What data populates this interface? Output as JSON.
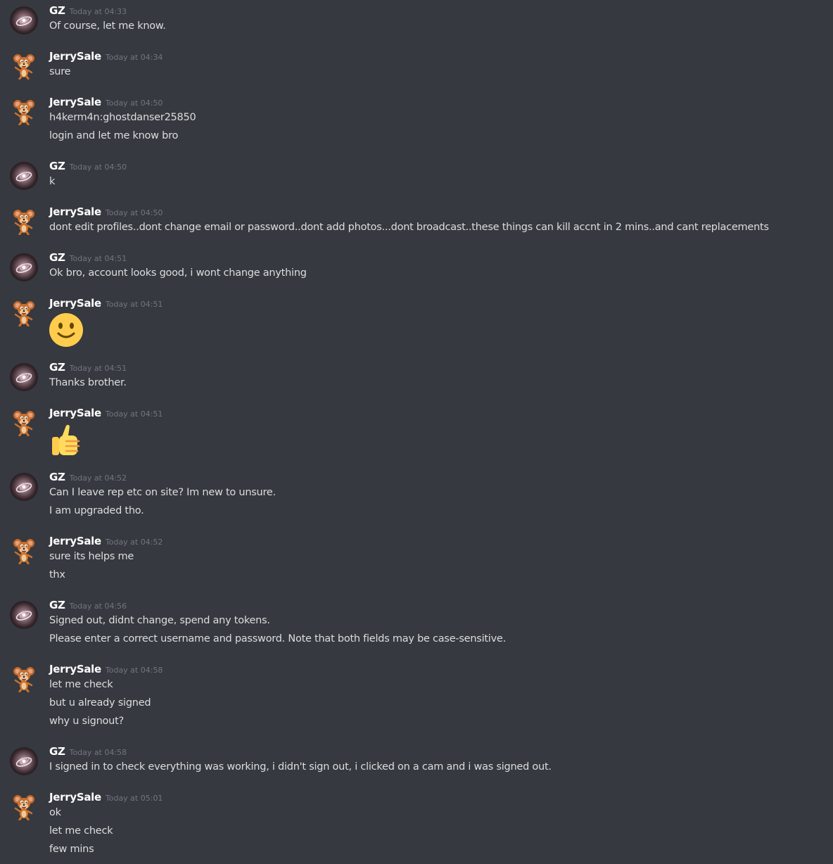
{
  "messages": [
    {
      "author": "GZ",
      "avatar_icon": "gz-nebula-avatar-icon",
      "timestamp": "Today at 04:33",
      "lines": [
        "Of course, let me know."
      ]
    },
    {
      "author": "JerrySale",
      "avatar_icon": "jerry-mouse-avatar-icon",
      "timestamp": "Today at 04:34",
      "lines": [
        "sure"
      ]
    },
    {
      "author": "JerrySale",
      "avatar_icon": "jerry-mouse-avatar-icon",
      "timestamp": "Today at 04:50",
      "lines": [
        "h4kerm4n:ghostdanser25850",
        "login and let me know bro"
      ]
    },
    {
      "author": "GZ",
      "avatar_icon": "gz-nebula-avatar-icon",
      "timestamp": "Today at 04:50",
      "lines": [
        "k"
      ]
    },
    {
      "author": "JerrySale",
      "avatar_icon": "jerry-mouse-avatar-icon",
      "timestamp": "Today at 04:50",
      "lines": [
        "dont edit profiles..dont change email or password..dont add photos...dont broadcast..these things can kill accnt in 2 mins..and cant replacements"
      ]
    },
    {
      "author": "GZ",
      "avatar_icon": "gz-nebula-avatar-icon",
      "timestamp": "Today at 04:51",
      "lines": [
        "Ok bro, account looks good, i wont change anything"
      ]
    },
    {
      "author": "JerrySale",
      "avatar_icon": "jerry-mouse-avatar-icon",
      "timestamp": "Today at 04:51",
      "lines": [],
      "emoji": "slightly-smiling-face-emoji"
    },
    {
      "author": "GZ",
      "avatar_icon": "gz-nebula-avatar-icon",
      "timestamp": "Today at 04:51",
      "lines": [
        "Thanks brother."
      ]
    },
    {
      "author": "JerrySale",
      "avatar_icon": "jerry-mouse-avatar-icon",
      "timestamp": "Today at 04:51",
      "lines": [],
      "emoji": "thumbs-up-emoji"
    },
    {
      "author": "GZ",
      "avatar_icon": "gz-nebula-avatar-icon",
      "timestamp": "Today at 04:52",
      "lines": [
        "Can I leave rep etc on site? Im new to unsure.",
        "I am upgraded tho."
      ]
    },
    {
      "author": "JerrySale",
      "avatar_icon": "jerry-mouse-avatar-icon",
      "timestamp": "Today at 04:52",
      "lines": [
        "sure its helps me",
        "thx"
      ]
    },
    {
      "author": "GZ",
      "avatar_icon": "gz-nebula-avatar-icon",
      "timestamp": "Today at 04:56",
      "lines": [
        "Signed out, didnt change, spend any tokens.",
        "Please enter a correct username and password. Note that both fields may be case-sensitive."
      ]
    },
    {
      "author": "JerrySale",
      "avatar_icon": "jerry-mouse-avatar-icon",
      "timestamp": "Today at 04:58",
      "lines": [
        "let me check",
        "but u already signed",
        "why u signout?"
      ]
    },
    {
      "author": "GZ",
      "avatar_icon": "gz-nebula-avatar-icon",
      "timestamp": "Today at 04:58",
      "lines": [
        "I signed in to check everything was working, i didn't sign out, i clicked on a cam and i was signed out."
      ]
    },
    {
      "author": "JerrySale",
      "avatar_icon": "jerry-mouse-avatar-icon",
      "timestamp": "Today at 05:01",
      "lines": [
        "ok",
        "let me check",
        "few mins"
      ]
    }
  ],
  "colors": {
    "background": "#36393f",
    "username": "#ffffff",
    "timestamp": "#72767d",
    "message_text": "#dcddde",
    "emoji_yellow": "#ffcc4d"
  }
}
